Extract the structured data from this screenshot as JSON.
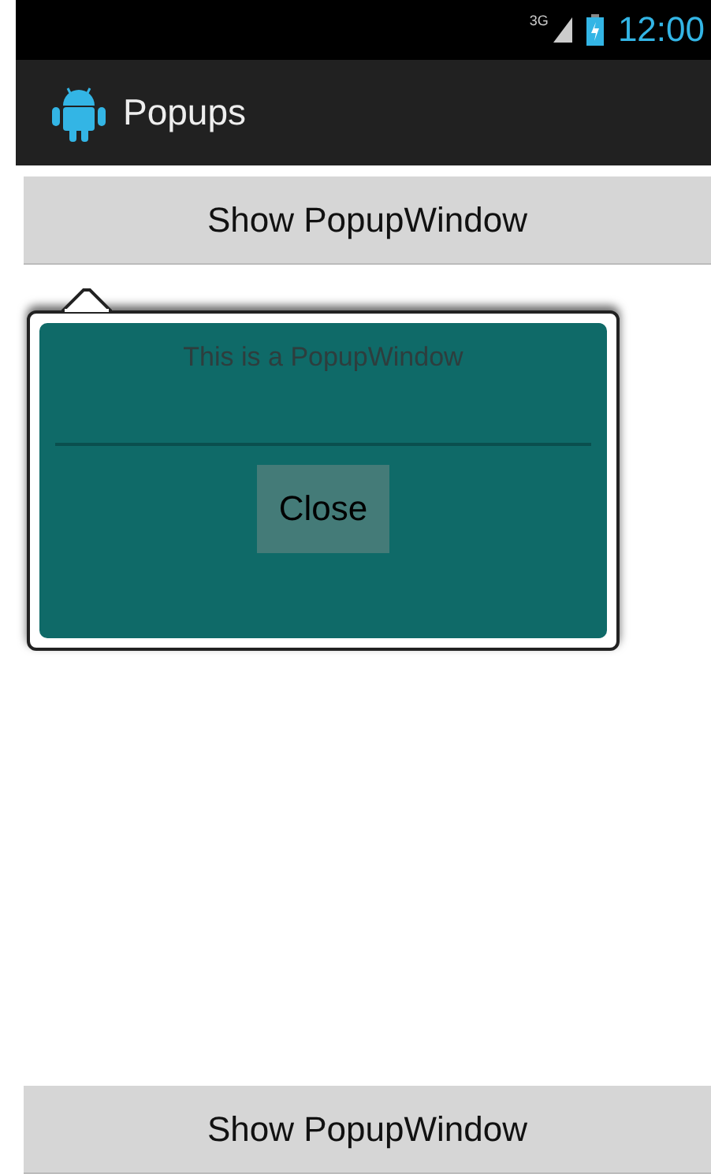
{
  "status_bar": {
    "network": "3G",
    "time": "12:00"
  },
  "action_bar": {
    "title": "Popups"
  },
  "buttons": [
    "Show PopupWindow",
    "Show PopupWindow"
  ],
  "popup": {
    "message": "This is a PopupWindow",
    "button": "Close"
  }
}
